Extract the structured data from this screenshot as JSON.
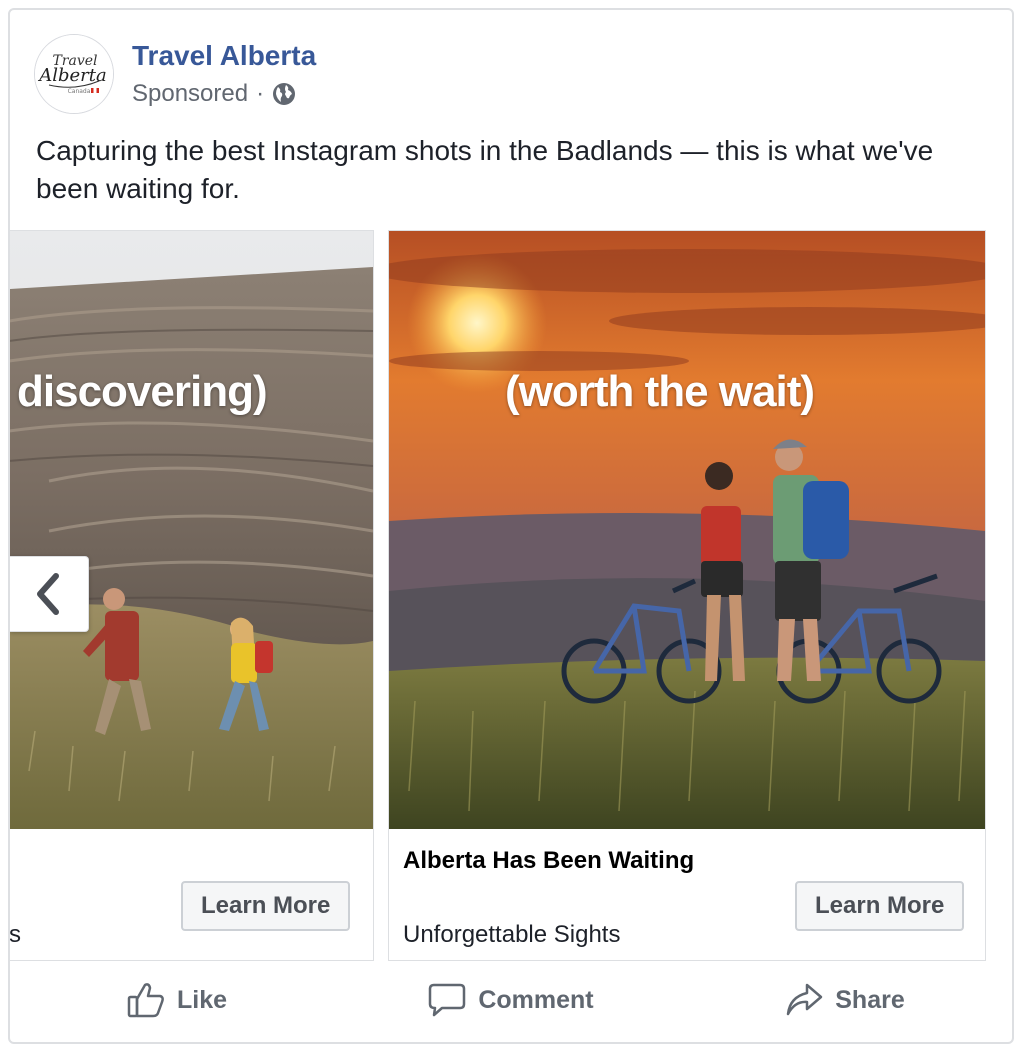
{
  "post": {
    "page_name": "Travel Alberta",
    "sponsored_label": "Sponsored",
    "separator": "·",
    "text": "Capturing the best Instagram shots in the Badlands — this is what we've been waiting for.",
    "logo": {
      "line1": "Travel",
      "line2": "Alberta",
      "line3": "Canada"
    }
  },
  "carousel": {
    "left": {
      "overlay": "discovering)",
      "description_fragment": "s",
      "cta": "Learn More"
    },
    "right": {
      "overlay": "(worth the wait)",
      "title": "Alberta Has Been Waiting",
      "description": "Unforgettable Sights",
      "cta": "Learn More"
    }
  },
  "actions": {
    "like": "Like",
    "comment": "Comment",
    "share": "Share"
  },
  "colors": {
    "brand_link": "#385898",
    "secondary_text": "#616770",
    "border": "#dddfe2"
  }
}
